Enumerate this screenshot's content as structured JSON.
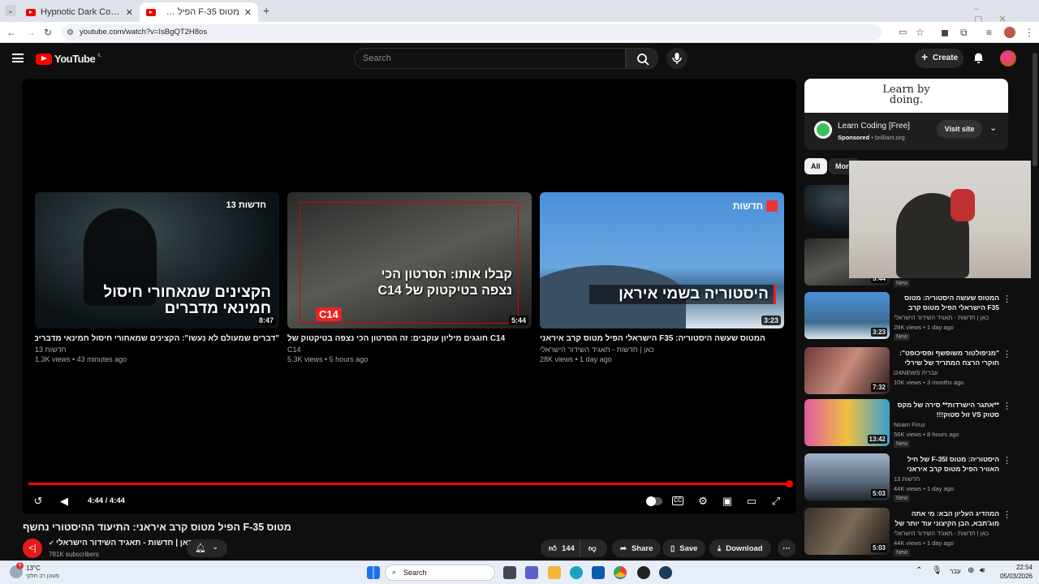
{
  "browser": {
    "tabs": [
      {
        "title": "Hypnotic Dark Code | Futuristic"
      },
      {
        "title": "מטוס F-35 הפיל מטוס קרב אירי"
      }
    ],
    "url": "youtube.com/watch?v=IsBgQT2H8os"
  },
  "header": {
    "logo": "YouTube",
    "region": "IL",
    "search_placeholder": "Search",
    "create_label": "Create"
  },
  "player": {
    "end_cards": [
      {
        "caption": "הקצינים שמאחורי חיסול חמינאי מדברים",
        "duration": "8:47",
        "title": "\"דברים שמעולם לא נעשו\": הקצינים שמאחורי חיסול חמינאי מדברים",
        "channel": "חדשות 13",
        "meta": "1.3K views • 43 minutes ago",
        "badge": "חדשות 13"
      },
      {
        "caption": "קבלו אותו: הסרטון הכי נצפה בטיקטוק של C14",
        "duration": "5:44",
        "title": "C14 חוגגים מיליון עוקבים: זה הסרטון הכי נצפה בטיקטוק של",
        "channel": "C14",
        "meta": "5.3K views • 5 hours ago",
        "badge": "C14"
      },
      {
        "caption": "היסטוריה בשמי איראן",
        "duration": "3:23",
        "title": "המטוס שעשה היסטוריה: F35 הישראלי הפיל מטוס קרב איראני",
        "channel": "כאן | חדשות - תאגיד השידור הישראלי",
        "meta": "28K views • 1 day ago",
        "badge": "חדשות"
      }
    ],
    "time": "4:44 / 4:44",
    "progress": 1.0
  },
  "video": {
    "title": "מטוס F-35 הפיל מטוס קרב איראני: התיעוד ההיסטורי נחשף",
    "channel": "כאן | חדשות - תאגיד השידור הישראלי",
    "subscribers": "781K subscribers",
    "likes": "144",
    "share_label": "Share",
    "save_label": "Save",
    "download_label": "Download"
  },
  "ad": {
    "banner": "Learn by doing.",
    "title": "Learn Coding [Free]",
    "sponsored": "Sponsored",
    "domain": "brilliant.org",
    "cta": "Visit site"
  },
  "chips": [
    "All",
    "More"
  ],
  "sidebar": [
    {
      "duration": "",
      "title": "",
      "channel": "",
      "meta": "",
      "new": ""
    },
    {
      "duration": "5:44",
      "title": "",
      "channel": "",
      "meta": "",
      "new": "New"
    },
    {
      "duration": "3:23",
      "title": "המטוס שעשה היסטוריה: מטוס F35 הישראלי הפיל מטוס קרב איראני",
      "channel": "כאן | חדשות - תאגיד השידור הישראלי",
      "meta": "28K views • 1 day ago",
      "new": "New"
    },
    {
      "duration": "7:32",
      "title": "\"מניפולטור משופשף ופסיכופט\": חוקרי הרצח המתריד של שירלי יהודה ...",
      "channel": "i24NEWS עברית",
      "meta": "10K views • 3 months ago",
      "new": ""
    },
    {
      "duration": "13:42",
      "title": "**אתגר הישרדות** סירה של מקס סטוק VS זול סטוק!!!",
      "channel": "Noam Firuz",
      "meta": "56K views • 8 hours ago",
      "new": "New"
    },
    {
      "duration": "5:03",
      "title": "היסטוריה: מטוס F-35I של חיל האוויר הפיל מטוס קרב איראני בשמי טהרן",
      "channel": "חדשות 13",
      "meta": "44K views • 1 day ago",
      "new": "New"
    },
    {
      "duration": "5:03",
      "title": "המהדיג העליון הבא: מי אתה מוג'תבא, הבן הקיצוני עוד יותר של חמינאי?",
      "channel": "כאן | חדשות - תאגיד השידור הישראלי",
      "meta": "44K views • 1 day ago",
      "new": "New"
    }
  ],
  "taskbar": {
    "weather_temp": "13°C",
    "weather_desc": "מעונן רב חלקי",
    "search_label": "Search",
    "lang": "עבר",
    "time": "22:54",
    "date": "05/03/2026",
    "badge": "5"
  },
  "colors": {
    "accent": "#ff0000",
    "bg": "#0f0f0f",
    "chip_active": "#f1f1f1"
  }
}
